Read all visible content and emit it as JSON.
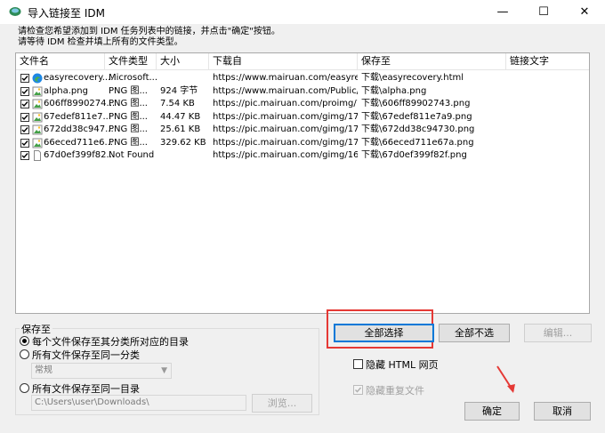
{
  "window": {
    "title": "导入链接至 IDM",
    "minimize": "—",
    "maximize": "☐",
    "close": "✕"
  },
  "instructions": {
    "line1": "请检查您希望添加到 IDM 任务列表中的链接，并点击\"确定\"按钮。",
    "line2": "请等待 IDM 检查并填上所有的文件类型。"
  },
  "table": {
    "columns": [
      "文件名",
      "文件类型",
      "大小",
      "下载自",
      "保存至",
      "链接文字"
    ],
    "rows": [
      {
        "checked": true,
        "icon": "edge-icon",
        "name": "easyrecovery....",
        "type": "Microsoft...",
        "size": "",
        "from": "https://www.mairuan.com/easyreco...",
        "save": "下载\\easyrecovery.html",
        "link": ""
      },
      {
        "checked": true,
        "icon": "png-image-icon",
        "name": "alpha.png",
        "type": "PNG 图...",
        "size": "924 字节",
        "from": "https://www.mairuan.com/Public/im...",
        "save": "下载\\alpha.png",
        "link": ""
      },
      {
        "checked": true,
        "icon": "png-image-icon",
        "name": "606ff8990274...",
        "type": "PNG 图...",
        "size": "7.54 KB",
        "from": "https://pic.mairuan.com/proimg/128...",
        "save": "下载\\606ff89902743.png",
        "link": ""
      },
      {
        "checked": true,
        "icon": "png-image-icon",
        "name": "67edef811e7...",
        "type": "PNG 图...",
        "size": "44.47 KB",
        "from": "https://pic.mairuan.com/gimg/17436...",
        "save": "下载\\67edef811e7a9.png",
        "link": ""
      },
      {
        "checked": true,
        "icon": "png-image-icon",
        "name": "672dd38c947...",
        "type": "PNG 图...",
        "size": "25.61 KB",
        "from": "https://pic.mairuan.com/gimg/17309...",
        "save": "下载\\672dd38c94730.png",
        "link": ""
      },
      {
        "checked": true,
        "icon": "png-image-icon",
        "name": "66eced711e6...",
        "type": "PNG 图...",
        "size": "329.62 KB",
        "from": "https://pic.mairuan.com/gimg/17268...",
        "save": "下载\\66eced711e67a.png",
        "link": ""
      },
      {
        "checked": true,
        "icon": "blank-file-icon",
        "name": "67d0ef399f82...",
        "type": "Not Found",
        "size": "",
        "from": "https://pic.mairuan.com/gimg/16178...",
        "save": "下载\\67d0ef399f82f.png",
        "link": ""
      }
    ]
  },
  "save_group": {
    "title": "保存至",
    "opt1": "每个文件保存至其分类所对应的目录",
    "opt2": "所有文件保存至同一分类",
    "category": "常规",
    "opt3": "所有文件保存至同一目录",
    "path": "C:\\Users\\user\\Downloads\\",
    "browse": "浏览..."
  },
  "buttons": {
    "select_all": "全部选择",
    "select_none": "全部不选",
    "edit": "编辑...",
    "ok": "确定",
    "cancel": "取消"
  },
  "options": {
    "hide_html": "隐藏 HTML 网页",
    "hide_dup": "隐藏重复文件"
  }
}
